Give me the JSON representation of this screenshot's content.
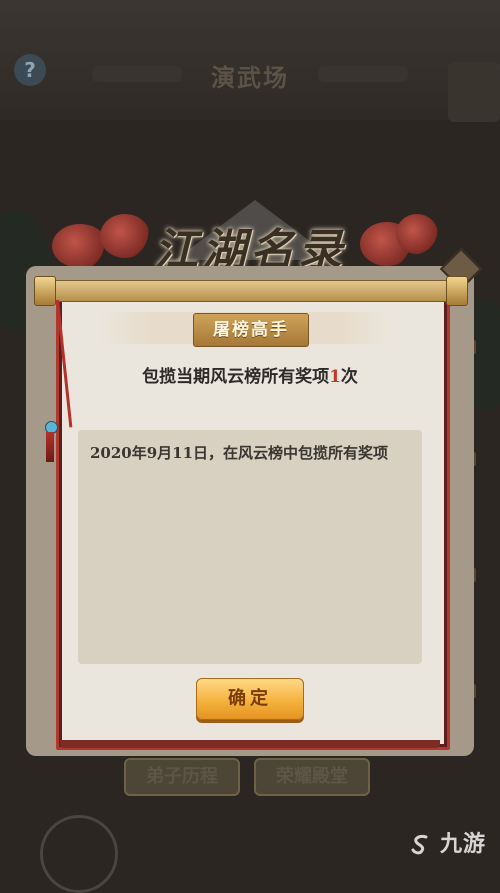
{
  "background": {
    "help_icon": "?",
    "screen_title": "演武场",
    "tabs": [
      "弟子历程",
      "荣耀殿堂"
    ]
  },
  "banner": {
    "title": "江湖名录"
  },
  "dialog": {
    "badge": "屠榜高手",
    "description_prefix": "包揽当期风云榜所有奖项",
    "description_count": "1",
    "description_suffix": "次",
    "detail": "2020年9月11日，在风云榜中包揽所有奖项",
    "confirm_label": "确定"
  },
  "watermark": {
    "text": "九游",
    "icon": "s-logo-icon"
  },
  "colors": {
    "accent_red": "#b1382e",
    "button_gold": "#f5b23e",
    "count_red": "#c03a2b"
  }
}
